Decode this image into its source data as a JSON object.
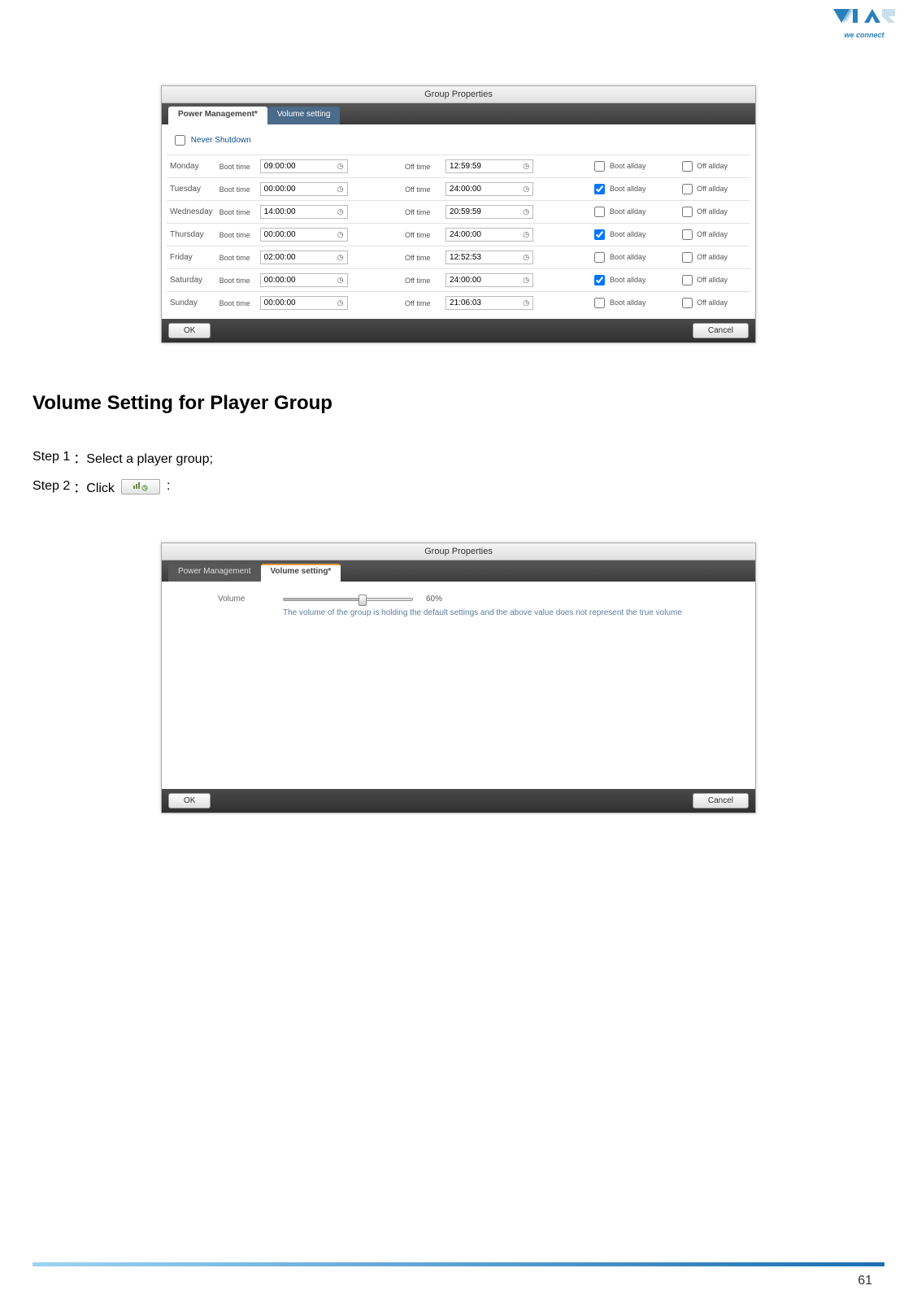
{
  "logo": {
    "tagline": "we connect"
  },
  "dialog1": {
    "title": "Group Properties",
    "tabs": {
      "power": "Power Management*",
      "volume": "Volume setting"
    },
    "never_shutdown": "Never Shutdown",
    "boot_label": "Boot time",
    "off_label": "Off time",
    "boot_allday": "Boot allday",
    "off_allday": "Off allday",
    "ok": "OK",
    "cancel": "Cancel",
    "rows": [
      {
        "day": "Monday",
        "boot": "09:00:00",
        "off": "12:59:59",
        "boot_checked": false,
        "off_checked": false
      },
      {
        "day": "Tuesday",
        "boot": "00:00:00",
        "off": "24:00:00",
        "boot_checked": true,
        "off_checked": false
      },
      {
        "day": "Wednesday",
        "boot": "14:00:00",
        "off": "20:59:59",
        "boot_checked": false,
        "off_checked": false
      },
      {
        "day": "Thursday",
        "boot": "00:00:00",
        "off": "24:00:00",
        "boot_checked": true,
        "off_checked": false
      },
      {
        "day": "Friday",
        "boot": "02:00:00",
        "off": "12:52:53",
        "boot_checked": false,
        "off_checked": false
      },
      {
        "day": "Saturday",
        "boot": "00:00:00",
        "off": "24:00:00",
        "boot_checked": true,
        "off_checked": false
      },
      {
        "day": "Sunday",
        "boot": "00:00:00",
        "off": "21:06:03",
        "boot_checked": false,
        "off_checked": false
      }
    ]
  },
  "text": {
    "heading": "Volume Setting for Player Group",
    "step1_a": "Step 1",
    "step1_b": "：Select a player group;",
    "step2_a": "Step 2",
    "step2_b": "：Click",
    "step2_c": ":"
  },
  "dialog2": {
    "title": "Group Properties",
    "tabs": {
      "power": "Power Management",
      "volume": "Volume setting*"
    },
    "volume_label": "Volume",
    "volume_value": "60%",
    "note": "The volume of the group is holding the default settings and the above value does not represent the true volume",
    "ok": "OK",
    "cancel": "Cancel"
  },
  "page_number": "61"
}
